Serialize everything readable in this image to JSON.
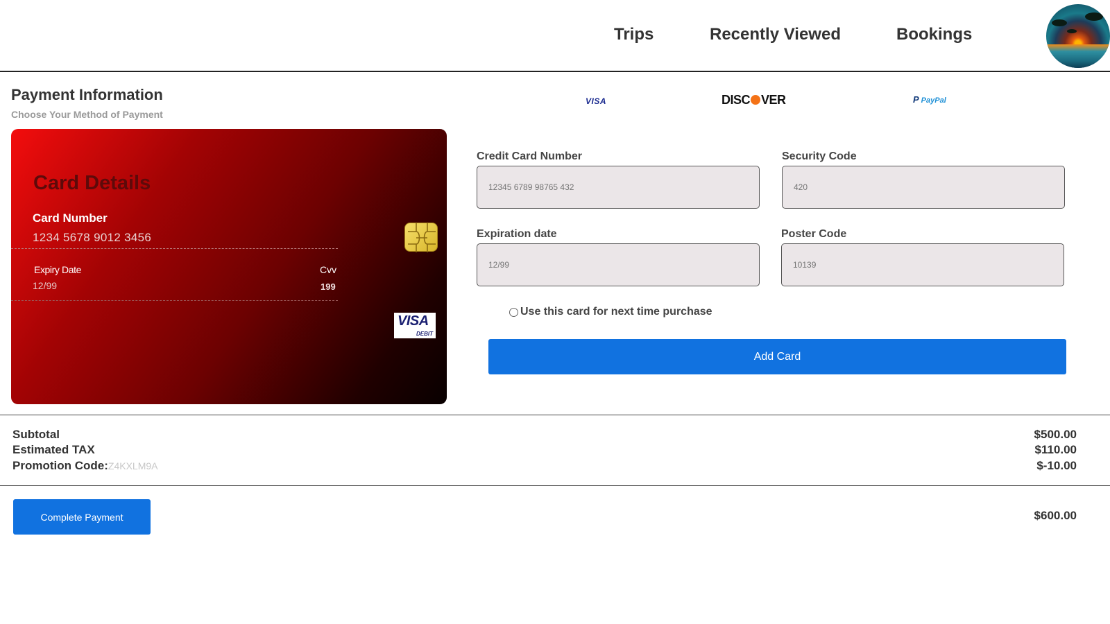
{
  "nav": {
    "items": [
      {
        "label": "Trips"
      },
      {
        "label": "Recently Viewed"
      },
      {
        "label": "Bookings"
      }
    ]
  },
  "payment": {
    "title": "Payment Information",
    "subtitle": "Choose Your Method of Payment",
    "methods": [
      "VISA",
      "DISCOVER",
      "PayPal"
    ]
  },
  "card": {
    "title": "Card Details",
    "number_label": "Card Number",
    "number": "1234 5678 9012 3456",
    "expiry_label": "Expiry Date",
    "expiry": "12/99",
    "cvv_label": "Cvv",
    "cvv": "199",
    "brand": "VISA",
    "brand_type": "DEBIT"
  },
  "form": {
    "credit_card_number": {
      "label": "Credit Card Number",
      "placeholder": "12345 6789 98765 432"
    },
    "security_code": {
      "label": "Security Code",
      "placeholder": "420"
    },
    "expiration_date": {
      "label": "Expiration date",
      "placeholder": "12/99"
    },
    "poster_code": {
      "label": "Poster Code",
      "placeholder": "10139"
    },
    "save_card_label": "Use this card for next time purchase",
    "add_card_button": "Add Card"
  },
  "summary": {
    "subtotal_label": "Subtotal",
    "subtotal": "$500.00",
    "tax_label": "Estimated TAX",
    "tax": "$110.00",
    "promo_label": "Promotion Code:",
    "promo_code": "Z4KXLM9A",
    "promo": "$-10.00",
    "total": "$600.00",
    "complete_button": "Complete Payment"
  },
  "colors": {
    "primary_button": "#1172e0",
    "card_gradient_start": "#f30d0d",
    "card_gradient_end": "#080000",
    "input_bg": "#ebe6e8"
  }
}
